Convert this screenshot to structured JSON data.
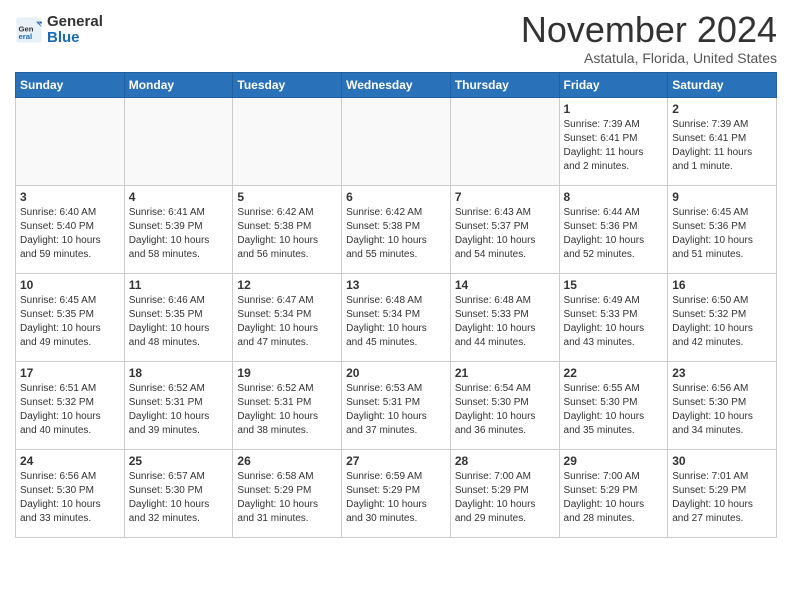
{
  "header": {
    "logo_general": "General",
    "logo_blue": "Blue",
    "month": "November 2024",
    "location": "Astatula, Florida, United States"
  },
  "weekdays": [
    "Sunday",
    "Monday",
    "Tuesday",
    "Wednesday",
    "Thursday",
    "Friday",
    "Saturday"
  ],
  "weeks": [
    [
      {
        "day": "",
        "info": ""
      },
      {
        "day": "",
        "info": ""
      },
      {
        "day": "",
        "info": ""
      },
      {
        "day": "",
        "info": ""
      },
      {
        "day": "",
        "info": ""
      },
      {
        "day": "1",
        "info": "Sunrise: 7:39 AM\nSunset: 6:41 PM\nDaylight: 11 hours\nand 2 minutes."
      },
      {
        "day": "2",
        "info": "Sunrise: 7:39 AM\nSunset: 6:41 PM\nDaylight: 11 hours\nand 1 minute."
      }
    ],
    [
      {
        "day": "3",
        "info": "Sunrise: 6:40 AM\nSunset: 5:40 PM\nDaylight: 10 hours\nand 59 minutes."
      },
      {
        "day": "4",
        "info": "Sunrise: 6:41 AM\nSunset: 5:39 PM\nDaylight: 10 hours\nand 58 minutes."
      },
      {
        "day": "5",
        "info": "Sunrise: 6:42 AM\nSunset: 5:38 PM\nDaylight: 10 hours\nand 56 minutes."
      },
      {
        "day": "6",
        "info": "Sunrise: 6:42 AM\nSunset: 5:38 PM\nDaylight: 10 hours\nand 55 minutes."
      },
      {
        "day": "7",
        "info": "Sunrise: 6:43 AM\nSunset: 5:37 PM\nDaylight: 10 hours\nand 54 minutes."
      },
      {
        "day": "8",
        "info": "Sunrise: 6:44 AM\nSunset: 5:36 PM\nDaylight: 10 hours\nand 52 minutes."
      },
      {
        "day": "9",
        "info": "Sunrise: 6:45 AM\nSunset: 5:36 PM\nDaylight: 10 hours\nand 51 minutes."
      }
    ],
    [
      {
        "day": "10",
        "info": "Sunrise: 6:45 AM\nSunset: 5:35 PM\nDaylight: 10 hours\nand 49 minutes."
      },
      {
        "day": "11",
        "info": "Sunrise: 6:46 AM\nSunset: 5:35 PM\nDaylight: 10 hours\nand 48 minutes."
      },
      {
        "day": "12",
        "info": "Sunrise: 6:47 AM\nSunset: 5:34 PM\nDaylight: 10 hours\nand 47 minutes."
      },
      {
        "day": "13",
        "info": "Sunrise: 6:48 AM\nSunset: 5:34 PM\nDaylight: 10 hours\nand 45 minutes."
      },
      {
        "day": "14",
        "info": "Sunrise: 6:48 AM\nSunset: 5:33 PM\nDaylight: 10 hours\nand 44 minutes."
      },
      {
        "day": "15",
        "info": "Sunrise: 6:49 AM\nSunset: 5:33 PM\nDaylight: 10 hours\nand 43 minutes."
      },
      {
        "day": "16",
        "info": "Sunrise: 6:50 AM\nSunset: 5:32 PM\nDaylight: 10 hours\nand 42 minutes."
      }
    ],
    [
      {
        "day": "17",
        "info": "Sunrise: 6:51 AM\nSunset: 5:32 PM\nDaylight: 10 hours\nand 40 minutes."
      },
      {
        "day": "18",
        "info": "Sunrise: 6:52 AM\nSunset: 5:31 PM\nDaylight: 10 hours\nand 39 minutes."
      },
      {
        "day": "19",
        "info": "Sunrise: 6:52 AM\nSunset: 5:31 PM\nDaylight: 10 hours\nand 38 minutes."
      },
      {
        "day": "20",
        "info": "Sunrise: 6:53 AM\nSunset: 5:31 PM\nDaylight: 10 hours\nand 37 minutes."
      },
      {
        "day": "21",
        "info": "Sunrise: 6:54 AM\nSunset: 5:30 PM\nDaylight: 10 hours\nand 36 minutes."
      },
      {
        "day": "22",
        "info": "Sunrise: 6:55 AM\nSunset: 5:30 PM\nDaylight: 10 hours\nand 35 minutes."
      },
      {
        "day": "23",
        "info": "Sunrise: 6:56 AM\nSunset: 5:30 PM\nDaylight: 10 hours\nand 34 minutes."
      }
    ],
    [
      {
        "day": "24",
        "info": "Sunrise: 6:56 AM\nSunset: 5:30 PM\nDaylight: 10 hours\nand 33 minutes."
      },
      {
        "day": "25",
        "info": "Sunrise: 6:57 AM\nSunset: 5:30 PM\nDaylight: 10 hours\nand 32 minutes."
      },
      {
        "day": "26",
        "info": "Sunrise: 6:58 AM\nSunset: 5:29 PM\nDaylight: 10 hours\nand 31 minutes."
      },
      {
        "day": "27",
        "info": "Sunrise: 6:59 AM\nSunset: 5:29 PM\nDaylight: 10 hours\nand 30 minutes."
      },
      {
        "day": "28",
        "info": "Sunrise: 7:00 AM\nSunset: 5:29 PM\nDaylight: 10 hours\nand 29 minutes."
      },
      {
        "day": "29",
        "info": "Sunrise: 7:00 AM\nSunset: 5:29 PM\nDaylight: 10 hours\nand 28 minutes."
      },
      {
        "day": "30",
        "info": "Sunrise: 7:01 AM\nSunset: 5:29 PM\nDaylight: 10 hours\nand 27 minutes."
      }
    ]
  ]
}
